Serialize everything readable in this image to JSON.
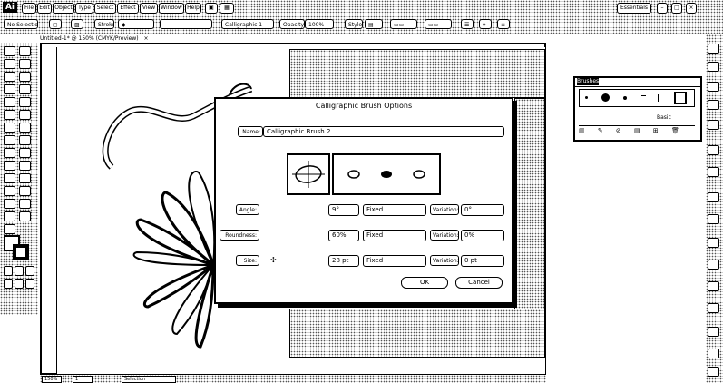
{
  "app": {
    "logo": "Ai",
    "menu": [
      "File",
      "Edit",
      "Object",
      "Type",
      "Select",
      "Effect",
      "View",
      "Window",
      "Help"
    ],
    "workspace": "Essentials"
  },
  "control_bar": {
    "selection_label": "No Selection",
    "brush_label": "Calligraphic 1",
    "style_label": "Style:",
    "opacity_label": "100%"
  },
  "document": {
    "tab_title": "Untitled-1* @ 150% (CMYK/Preview)",
    "close": "×"
  },
  "dialog": {
    "title": "Calligraphic Brush Options",
    "name_label": "Name:",
    "name_value": "Calligraphic Brush 2",
    "rows": [
      {
        "label": "Angle:",
        "value": "9°",
        "mode": "Fixed",
        "variation_label": "Variation:",
        "variation_value": "0°"
      },
      {
        "label": "Roundness:",
        "value": "60%",
        "mode": "Fixed",
        "variation_label": "Variation:",
        "variation_value": "0%"
      },
      {
        "label": "Size:",
        "value": "28 pt",
        "mode": "Fixed",
        "variation_label": "Variation:",
        "variation_value": "0 pt"
      }
    ],
    "ok": "OK",
    "cancel": "Cancel"
  },
  "brushes_panel": {
    "tab": "Brushes",
    "basic_label": "Basic"
  },
  "status": {
    "zoom": "150%",
    "artboard": "1",
    "tool": "Selection"
  }
}
